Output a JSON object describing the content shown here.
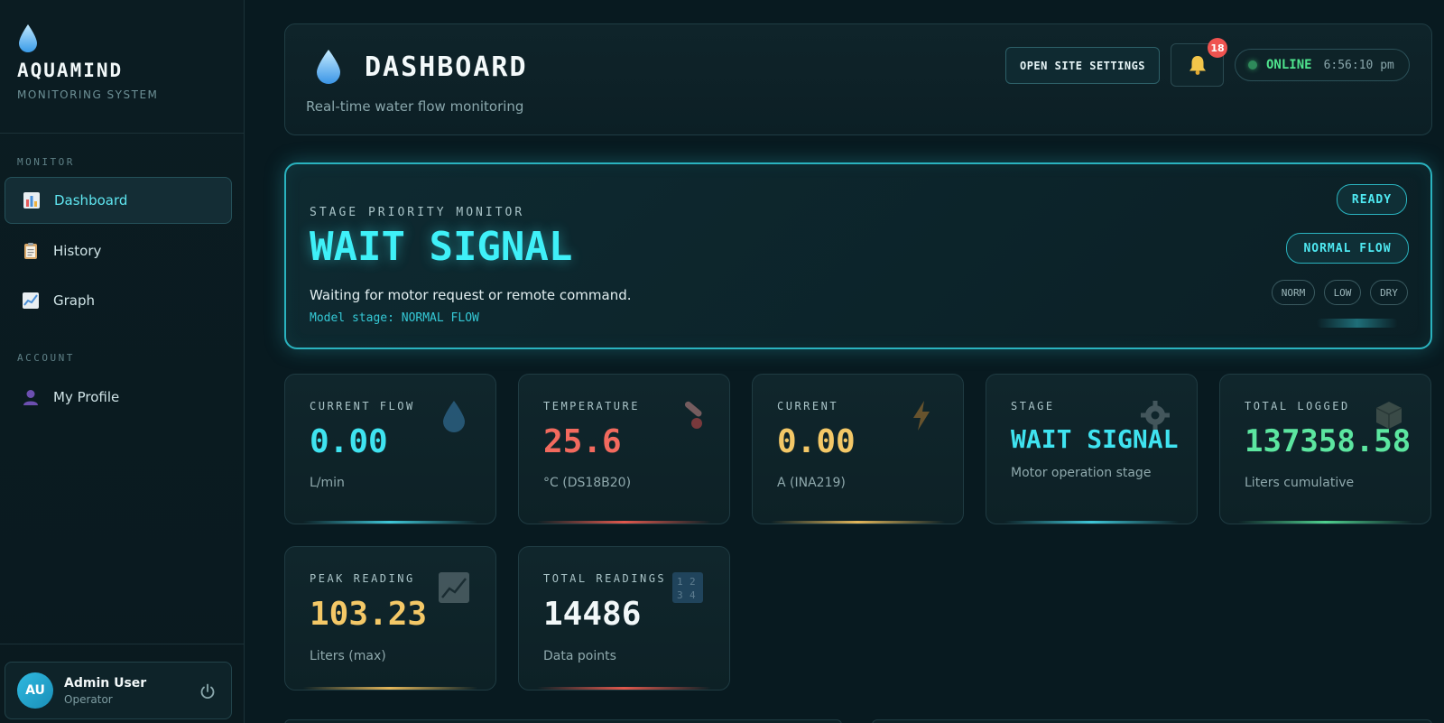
{
  "sidebar": {
    "brand_name": "AQUAMIND",
    "brand_subtitle": "MONITORING SYSTEM",
    "sections": {
      "monitor": "MONITOR",
      "account": "ACCOUNT"
    },
    "items": [
      {
        "label": "Dashboard",
        "icon": "bar-chart-icon",
        "active": true
      },
      {
        "label": "History",
        "icon": "clipboard-icon",
        "active": false
      },
      {
        "label": "Graph",
        "icon": "line-chart-icon",
        "active": false
      },
      {
        "label": "My Profile",
        "icon": "user-icon",
        "active": false
      }
    ],
    "user": {
      "initials": "AU",
      "name": "Admin User",
      "role": "Operator"
    }
  },
  "header": {
    "title": "DASHBOARD",
    "subtitle": "Real-time water flow monitoring",
    "settings_label": "OPEN SITE SETTINGS",
    "notification_count": "18",
    "status_label": "ONLINE",
    "status_time": "6:56:10 pm"
  },
  "stage_monitor": {
    "label": "STAGE PRIORITY MONITOR",
    "value": "WAIT SIGNAL",
    "description": "Waiting for motor request or remote command.",
    "model_prefix": "Model stage:",
    "model_value": "NORMAL FLOW",
    "ready_chip": "READY",
    "flow_chip": "NORMAL FLOW",
    "mini_chips": [
      "NORM",
      "LOW",
      "DRY"
    ]
  },
  "metrics": [
    {
      "label": "CURRENT FLOW",
      "value": "0.00",
      "unit": "L/min",
      "icon": "water-drop-icon",
      "color": "#3fe3f0"
    },
    {
      "label": "TEMPERATURE",
      "value": "25.6",
      "unit": "°C (DS18B20)",
      "icon": "thermometer-icon",
      "color": "#f26a5e"
    },
    {
      "label": "CURRENT",
      "value": "0.00",
      "unit": "A (INA219)",
      "icon": "lightning-icon",
      "color": "#f4c867"
    },
    {
      "label": "STAGE",
      "value": "WAIT SIGNAL",
      "unit": "Motor operation stage",
      "icon": "gear-icon",
      "color": "#3fe3f0"
    },
    {
      "label": "TOTAL LOGGED",
      "value": "137358.58",
      "unit": "Liters cumulative",
      "icon": "box-icon",
      "color": "#5ce6a0"
    },
    {
      "label": "PEAK READING",
      "value": "103.23",
      "unit": "Liters (max)",
      "icon": "trend-chart-icon",
      "color": "#f4c867"
    },
    {
      "label": "TOTAL READINGS",
      "value": "14486",
      "unit": "Data points",
      "icon": "numbers-icon",
      "color": "#f1f7f8"
    }
  ]
}
